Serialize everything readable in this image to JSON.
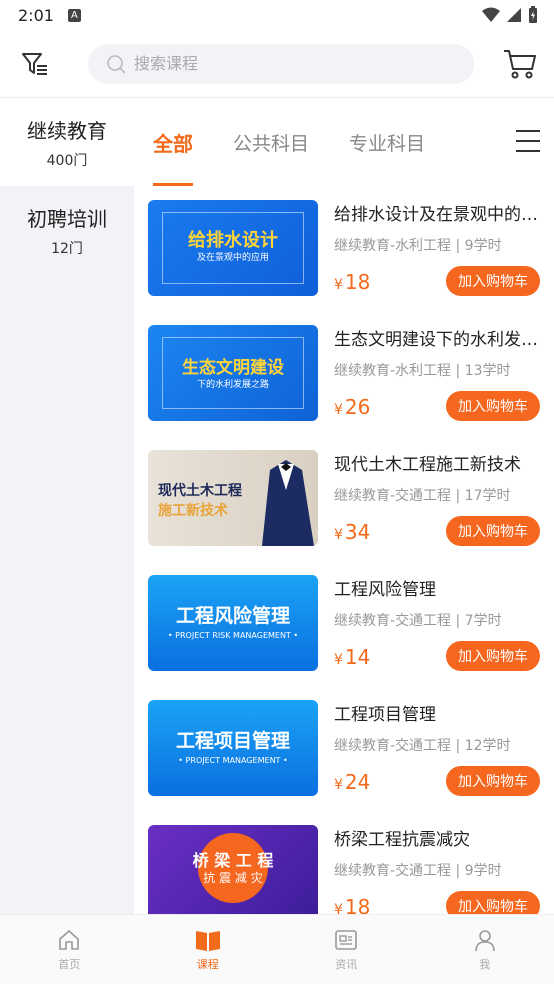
{
  "status": {
    "time": "2:01",
    "badge": "A"
  },
  "search": {
    "placeholder": "搜索课程"
  },
  "sidebar": {
    "items": [
      {
        "name": "继续教育",
        "count": "400门"
      },
      {
        "name": "初聘培训",
        "count": "12门"
      }
    ]
  },
  "tabs": [
    "全部",
    "公共科目",
    "专业科目"
  ],
  "courses": [
    {
      "title": "给排水设计及在景观中的应用",
      "meta": "继续教育-水利工程 | 9学时",
      "yen": "¥",
      "price": "18",
      "add_label": "加入购物车",
      "thumb_title": "给排水设计",
      "thumb_sub": "及在景观中的应用"
    },
    {
      "title": "生态文明建设下的水利发展之路",
      "meta": "继续教育-水利工程 | 13学时",
      "yen": "¥",
      "price": "26",
      "add_label": "加入购物车",
      "thumb_title": "生态文明建设",
      "thumb_sub": "下的水利发展之路"
    },
    {
      "title": "现代土木工程施工新技术",
      "meta": "继续教育-交通工程 | 17学时",
      "yen": "¥",
      "price": "34",
      "add_label": "加入购物车",
      "thumb_title": "现代土木工程",
      "thumb_sub": "施工新技术"
    },
    {
      "title": "工程风险管理",
      "meta": "继续教育-交通工程 | 7学时",
      "yen": "¥",
      "price": "14",
      "add_label": "加入购物车",
      "thumb_title": "工程风险管理",
      "thumb_sub": "• PROJECT RISK MANAGEMENT •"
    },
    {
      "title": "工程项目管理",
      "meta": "继续教育-交通工程 | 12学时",
      "yen": "¥",
      "price": "24",
      "add_label": "加入购物车",
      "thumb_title": "工程项目管理",
      "thumb_sub": "• PROJECT MANAGEMENT •"
    },
    {
      "title": "桥梁工程抗震减灾",
      "meta": "继续教育-交通工程 | 9学时",
      "yen": "¥",
      "price": "18",
      "add_label": "加入购物车",
      "thumb_title": "桥 梁 工 程",
      "thumb_sub": "抗 震 减 灾"
    }
  ],
  "tabbar": [
    {
      "label": "首页",
      "icon": "home-icon"
    },
    {
      "label": "课程",
      "icon": "book-icon"
    },
    {
      "label": "资讯",
      "icon": "news-icon"
    },
    {
      "label": "我",
      "icon": "user-icon"
    }
  ],
  "colors": {
    "accent": "#f26a1b",
    "sidebar_bg": "#f2f3f7"
  }
}
